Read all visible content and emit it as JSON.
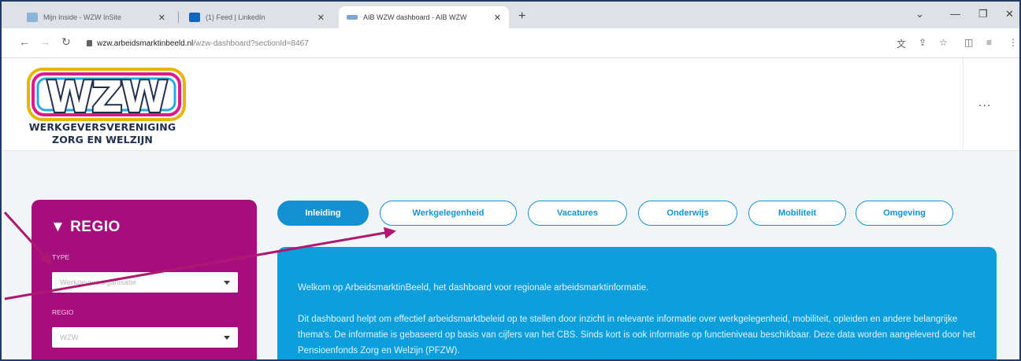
{
  "browser": {
    "tabs": [
      {
        "title": "Mijn Inside - WZW InSite",
        "favicon_color": "#8ab4d8"
      },
      {
        "title": "(1) Feed | LinkedIn",
        "favicon_color": "#0a66c2"
      },
      {
        "title": "AIB WZW dashboard - AIB WZW",
        "favicon_color": "#7aa7d4"
      }
    ],
    "address": {
      "host": "wzw.arbeidsmarktinbeeld.nl",
      "path": "/wzw-dashboard?sectionId=8467"
    }
  },
  "header": {
    "logo_text": "WZW",
    "org_name_line1": "WERKGEVERSVERENIGING",
    "org_name_line2": "ZORG EN WELZIJN",
    "more_label": "..."
  },
  "regio_panel": {
    "title": "▼ REGIO",
    "type_label": "TYPE",
    "type_value": "Werkgeversorganisatie",
    "regio_label": "REGIO",
    "regio_value": "WZW"
  },
  "tabs": [
    {
      "label": "Inleiding",
      "active": true
    },
    {
      "label": "Werkgelegenheid",
      "active": false
    },
    {
      "label": "Vacatures",
      "active": false
    },
    {
      "label": "Onderwijs",
      "active": false
    },
    {
      "label": "Mobiliteit",
      "active": false
    },
    {
      "label": "Omgeving",
      "active": false
    }
  ],
  "content": {
    "intro": "Welkom op ArbeidsmarktinBeeld, het dashboard voor regionale arbeidsmarktinformatie.",
    "body": "Dit dashboard helpt om effectief arbeidsmarktbeleid op te stellen door inzicht in relevante informatie over werkgelegenheid, mobiliteit, opleiden en andere belangrijke thema's. De informatie is gebaseerd op basis van cijfers van het CBS. Sinds kort is ook informatie op functieniveau beschikbaar. Deze data worden aangeleverd door het Pensioenfonds Zorg en Welzijn (PFZW)."
  },
  "colors": {
    "primary_blue": "#1591d3",
    "content_blue": "#0d9fdc",
    "regio_magenta": "#a70e7d",
    "annotation_arrow": "#b0176f"
  }
}
